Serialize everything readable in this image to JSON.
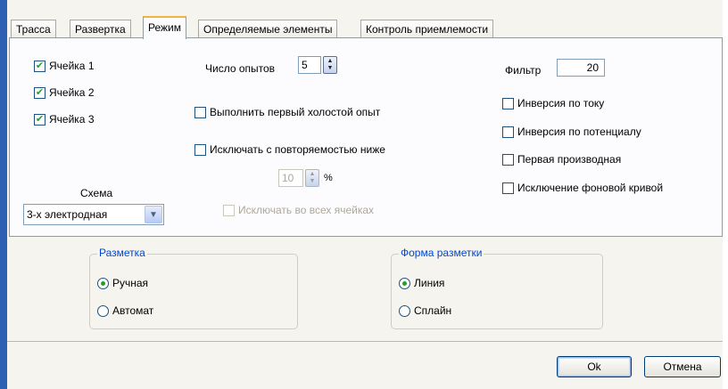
{
  "tabs": [
    {
      "label": "Трасса"
    },
    {
      "label": "Развертка"
    },
    {
      "label": "Режим"
    },
    {
      "label": "Определяемые элементы"
    },
    {
      "label": "Контроль приемлемости"
    }
  ],
  "cells": [
    {
      "label": "Ячейка 1",
      "checked": true
    },
    {
      "label": "Ячейка 2",
      "checked": true
    },
    {
      "label": "Ячейка 3",
      "checked": true
    }
  ],
  "scheme": {
    "label": "Схема",
    "value": "3-х электродная"
  },
  "experiments": {
    "label": "Число опытов",
    "value": "5"
  },
  "blank_run": {
    "label": "Выполнить первый холостой опыт",
    "checked": false
  },
  "exclude_repeat": {
    "label": "Исключать с повторяемостью ниже",
    "checked": false
  },
  "percent": {
    "value": "10",
    "unit": "%"
  },
  "exclude_all": {
    "label": "Исключать во всех ячейках",
    "checked": false
  },
  "filter": {
    "label": "Фильтр",
    "value": "20"
  },
  "options": [
    {
      "label": "Инверсия по току",
      "checked": false
    },
    {
      "label": "Инверсия по потенциалу",
      "checked": false
    },
    {
      "label": "Первая производная",
      "checked": false
    },
    {
      "label": "Исключение фоновой кривой",
      "checked": false
    }
  ],
  "markup": {
    "title": "Разметка",
    "options": [
      {
        "label": "Ручная",
        "selected": true
      },
      {
        "label": "Автомат",
        "selected": false
      }
    ]
  },
  "markup_shape": {
    "title": "Форма разметки",
    "options": [
      {
        "label": "Линия",
        "selected": true
      },
      {
        "label": "Сплайн",
        "selected": false
      }
    ]
  },
  "buttons": {
    "ok": "Ok",
    "cancel": "Отмена"
  },
  "colors": {
    "accent": "#0046d5",
    "check": "#21a121",
    "tab_highlight": "#f0b43c",
    "window_border": "#2d5fb3"
  }
}
